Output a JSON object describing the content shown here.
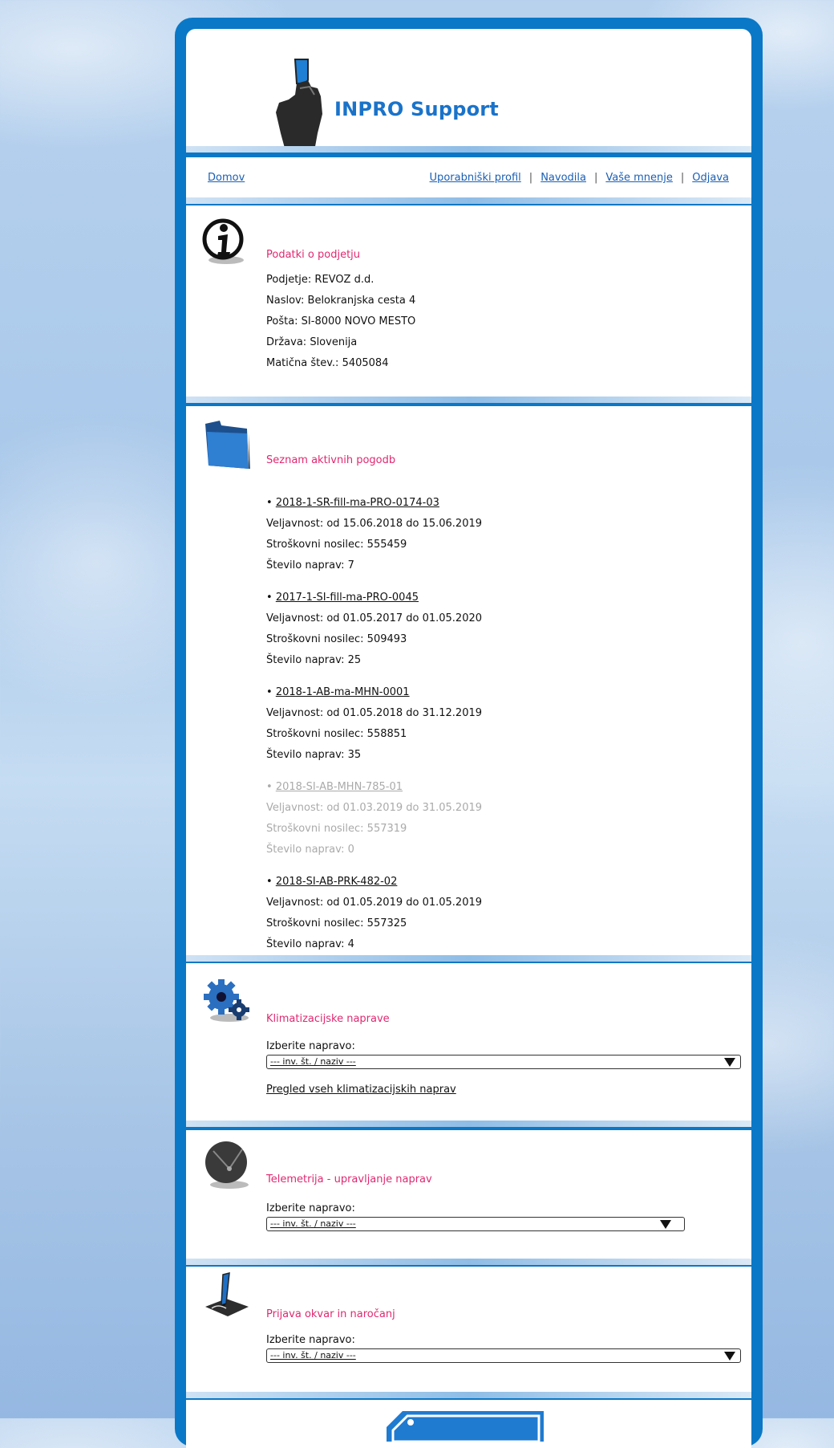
{
  "header": {
    "brand": "INPRO Support"
  },
  "nav": {
    "home": "Domov",
    "links": [
      "Uporabniški profil",
      "Navodila",
      "Vaše mnenje",
      "Odjava"
    ]
  },
  "info": {
    "title": "Podatki o podjetju",
    "lines": [
      "Podjetje: REVOZ d.d.",
      "Naslov: Belokranjska cesta 4",
      "Pošta: SI-8000 NOVO MESTO",
      "Država: Slovenija",
      "Matična štev.: 5405084"
    ]
  },
  "contracts": {
    "title": "Seznam aktivnih pogodb",
    "items": [
      {
        "code": "2018-1-SR-fill-ma-PRO-0174-03",
        "validity": "Veljavnost: od 15.06.2018 do 15.06.2019",
        "cost": "Stroškovni nosilec: 555459",
        "count": "Število naprav: 7",
        "inactive": false
      },
      {
        "code": "2017-1-SI-fill-ma-PRO-0045",
        "validity": "Veljavnost: od 01.05.2017 do 01.05.2020",
        "cost": "Stroškovni nosilec: 509493",
        "count": "Število naprav: 25",
        "inactive": false
      },
      {
        "code": "2018-1-AB-ma-MHN-0001",
        "validity": "Veljavnost: od 01.05.2018 do 31.12.2019",
        "cost": "Stroškovni nosilec: 558851",
        "count": "Število naprav: 35",
        "inactive": false
      },
      {
        "code": "2018-SI-AB-MHN-785-01",
        "validity": "Veljavnost: od 01.03.2019 do 31.05.2019",
        "cost": "Stroškovni nosilec: 557319",
        "count": "Število naprav: 0",
        "inactive": true
      },
      {
        "code": "2018-SI-AB-PRK-482-02",
        "validity": "Veljavnost: od 01.05.2019 do 01.05.2019",
        "cost": "Stroškovni nosilec: 557325",
        "count": "Število naprav: 4",
        "inactive": false
      }
    ]
  },
  "klima": {
    "title": "Klimatizacijske naprave",
    "select_label": "Izberite napravo:",
    "select_value": "--- inv. št. / naziv ---",
    "link": "Pregled vseh klimatizacijskih naprav"
  },
  "tele": {
    "title": "Telemetrija - upravljanje naprav",
    "select_label": "Izberite napravo:",
    "select_value": "--- inv. št. / naziv ---"
  },
  "prijava": {
    "title": "Prijava okvar in naročanj",
    "select_label": "Izberite napravo:",
    "select_value": "--- inv. št. / naziv ---"
  }
}
